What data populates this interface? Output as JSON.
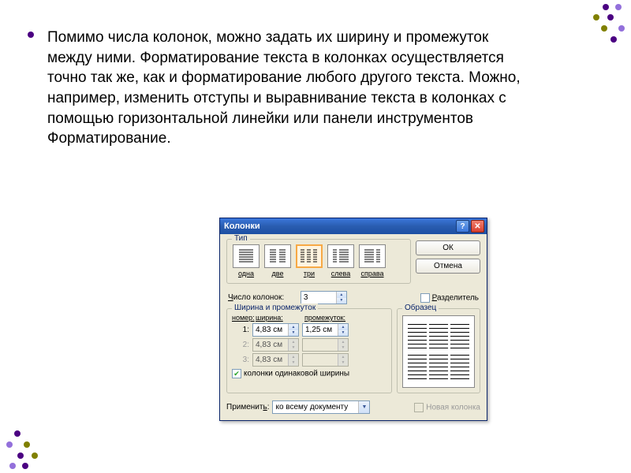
{
  "main_paragraph": "Помимо числа колонок, можно задать их ширину и промежуток между ними. Форматирование текста в колонках осуществляется точно так же, как и форматирование любого другого текста. Можно, например, изменить отступы и выравнивание текста в колонках с помощью горизонтальной линейки или панели инструментов Форматирование.",
  "dialog": {
    "title": "Колонки",
    "ok": "ОК",
    "cancel": "Отмена",
    "type_label": "Тип",
    "types": [
      "одна",
      "две",
      "три",
      "слева",
      "справа"
    ],
    "count_label": "Число колонок:",
    "count_value": "3",
    "separator_label": "Разделитель",
    "wp_label": "Ширина и промежуток",
    "wp_headers": {
      "num": "номер:",
      "width": "ширина:",
      "gap": "промежуток:"
    },
    "rows": [
      {
        "n": "1:",
        "w": "4,83 см",
        "g": "1,25 см"
      },
      {
        "n": "2:",
        "w": "4,83 см",
        "g": ""
      },
      {
        "n": "3:",
        "w": "4,83 см",
        "g": ""
      }
    ],
    "eq_label": "колонки одинаковой ширины",
    "sample_label": "Образец",
    "apply_label": "Применить:",
    "apply_value": "ко всему документу",
    "newcol_label": "Новая колонка"
  }
}
